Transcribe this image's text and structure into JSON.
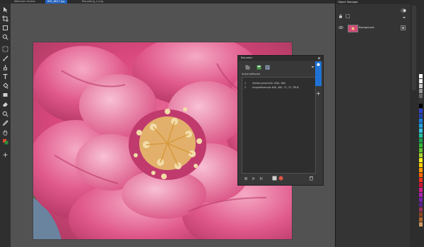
{
  "tabs": [
    {
      "label": "Welcome Screen",
      "active": false
    },
    {
      "label": "IMG_8617.jpg",
      "active": true
    },
    {
      "label": "Recording_1.png",
      "active": false
    }
  ],
  "toolbar": {
    "tools": [
      "pointer-tool",
      "crop-tool",
      "transform-tool",
      "zoom-tool",
      "mask-tool",
      "brush-tool",
      "clone-tool",
      "text-tool",
      "fill-tool",
      "shape-tool",
      "eraser-tool",
      "eyedropper-tool",
      "hand-tool",
      "color-picker-tool"
    ]
  },
  "recorder": {
    "title": "Recorder",
    "script_label": "Script toRecord",
    "rows": [
      {
        "num": "1",
        "text": "SetDocumentInfo 1280, 960"
      },
      {
        "num": "2",
        "text": "ImageResample 640, 480, 72, 72, TRUE"
      }
    ]
  },
  "object_manager": {
    "title": "Object Manager",
    "layer_name": "Background"
  },
  "colors": {
    "accent": "#1f5fbf",
    "record": "#e05545",
    "layer_thumb": "#d04a78"
  },
  "palette": {
    "swatches": [
      "#ffffff",
      "#eeeeee",
      "#cccccc",
      "#999999",
      "#666666",
      "#333333",
      "#000000",
      "#3344cc",
      "#2244aa",
      "#1d7fd8",
      "#22a0e0",
      "#3cc0e0",
      "#22c0a0",
      "#20a050",
      "#33b83a",
      "#66c133",
      "#aad033",
      "#ffee22",
      "#ffcc00",
      "#ff9900",
      "#ff6600",
      "#ee3322",
      "#cc1133",
      "#cc2288",
      "#aa22aa",
      "#7722aa",
      "#552288",
      "#993355",
      "#884422",
      "#aa6633",
      "#cc9966"
    ]
  }
}
